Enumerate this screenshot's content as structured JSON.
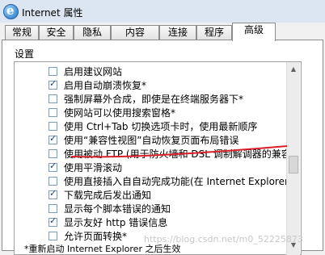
{
  "window": {
    "title": "Internet 属性",
    "icon": "ie-icon"
  },
  "tabs": [
    {
      "label": "常规",
      "active": false
    },
    {
      "label": "安全",
      "active": false
    },
    {
      "label": "隐私",
      "active": false
    },
    {
      "label": "内容",
      "active": false
    },
    {
      "label": "连接",
      "active": false
    },
    {
      "label": "程序",
      "active": false
    },
    {
      "label": "高级",
      "active": true
    }
  ],
  "settings": {
    "section_label": "设置",
    "items": [
      {
        "label": "启用建议网站",
        "checked": false
      },
      {
        "label": "启用自动崩溃恢复*",
        "checked": true
      },
      {
        "label": "强制屏幕外合成，即使是在终端服务器下*",
        "checked": false
      },
      {
        "label": "使网站可以使用搜索窗格*",
        "checked": false
      },
      {
        "label": "使用 Ctrl+Tab 切换选项卡时，使用最新顺序",
        "checked": false
      },
      {
        "label": "使用“兼容性视图”自动恢复页面布局错误",
        "checked": true
      },
      {
        "label": "使用被动 FTP (用于防火墙和 DSL 调制解调器的兼容",
        "checked": false
      },
      {
        "label": "使用平滑滚动",
        "checked": true
      },
      {
        "label": "使用直接插入自自动完成功能(在 Internet Explorer",
        "checked": false
      },
      {
        "label": "下载完成后发出通知",
        "checked": true
      },
      {
        "label": "显示每个脚本错误的通知",
        "checked": false
      },
      {
        "label": "显示友好 http 错误信息",
        "checked": true
      },
      {
        "label": "允许页面转换*",
        "checked": false
      }
    ],
    "footnote": "*重新启动 Internet Explorer 之后生效"
  },
  "watermark": "https://blog.csdn.net/m0_52225873",
  "annotation": {
    "color": "#d9202a"
  }
}
